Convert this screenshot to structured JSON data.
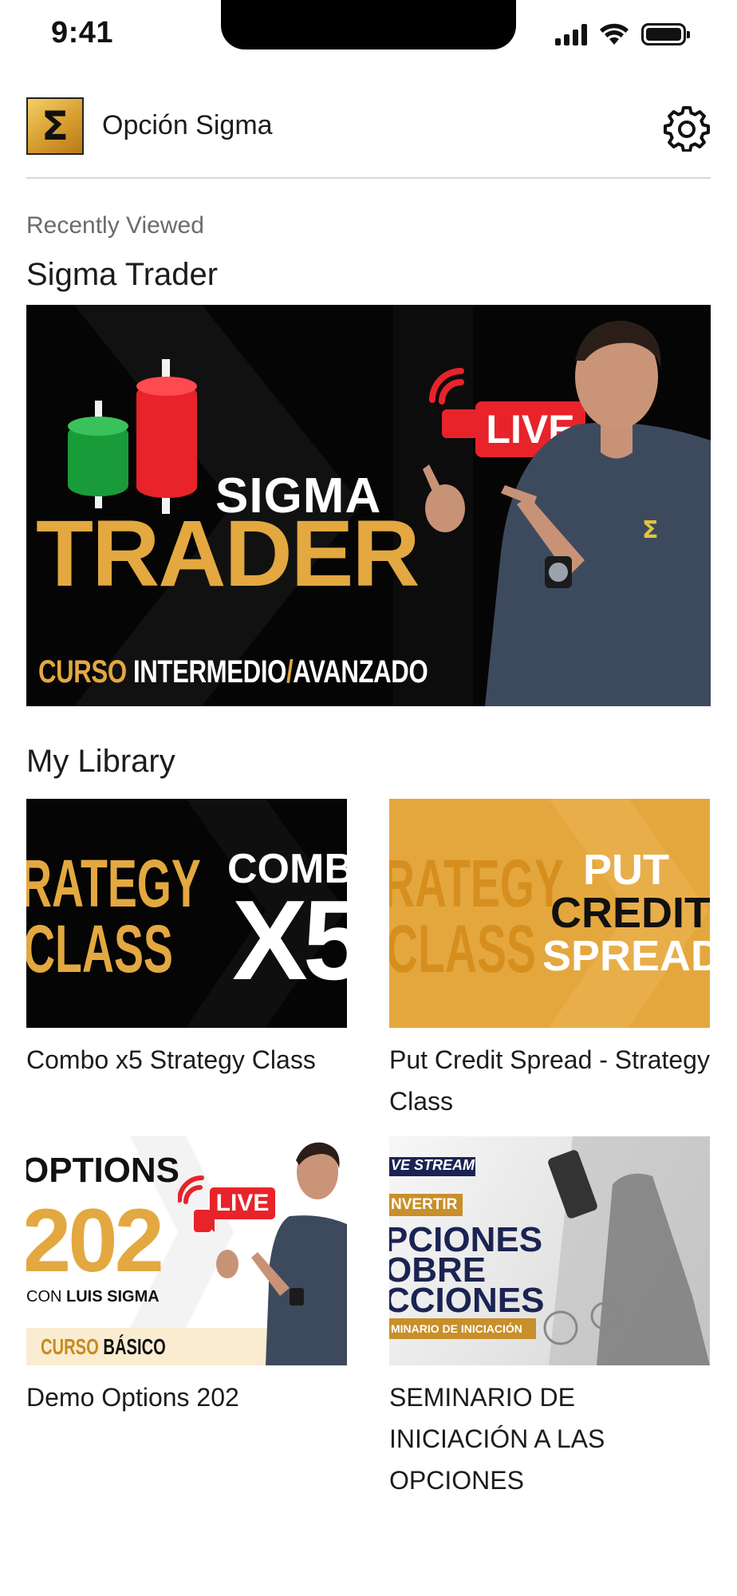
{
  "status_bar": {
    "time": "9:41"
  },
  "header": {
    "logo_glyph": "Σ",
    "app_title": "Opción Sigma",
    "settings_icon": "gear-icon"
  },
  "recent": {
    "kicker": "Recently Viewed",
    "title": "Sigma Trader",
    "hero": {
      "sigma_text": "SIGMA",
      "trader_text": "TRADER",
      "course_prefix": "CURSO",
      "course_rest": "INTERMEDIO",
      "course_slash": "/",
      "course_level": "AVANZADO",
      "live_label": "LIVE"
    }
  },
  "library": {
    "title": "My Library",
    "items": [
      {
        "title": "Combo x5 Strategy Class",
        "thumb": {
          "line1": "RATEGY",
          "line2": "CLASS",
          "word_top": "COMB",
          "word_big": "X5"
        }
      },
      {
        "title": "Put Credit Spread - Strategy Class",
        "thumb": {
          "line1": "RATEGY",
          "line2": "CLASS",
          "word_a": "PUT",
          "word_b": "CREDIT",
          "word_c": "SPREAD"
        }
      },
      {
        "title": "Demo Options 202",
        "thumb": {
          "line1": "OPTIONS",
          "line2": "202",
          "line3_prefix": "CON",
          "line3_name": "LUIS SIGMA",
          "course_prefix": "CURSO",
          "course_level": "BÁSICO",
          "live_label": "LIVE"
        }
      },
      {
        "title": "SEMINARIO DE INICIACIÓN A LAS OPCIONES",
        "thumb": {
          "tag": "VE STREAM",
          "sub": "NVERTIR",
          "line1": "PCIONES",
          "line2": "OBRE",
          "line3": "CCIONES",
          "strip": "MINARIO DE INICIACIÓN"
        }
      }
    ]
  },
  "colors": {
    "gold": "#e3a840",
    "live_red": "#e8232a",
    "candle_green": "#1a9b3a",
    "candle_red": "#e8232a"
  }
}
